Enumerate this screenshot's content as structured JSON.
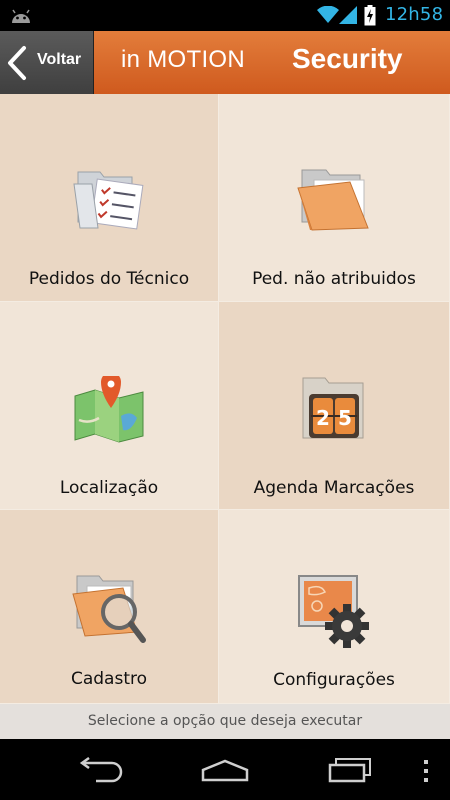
{
  "status_bar": {
    "time": "12h58"
  },
  "header": {
    "back_label": "Voltar",
    "brand": "in MOTION",
    "section": "Security"
  },
  "menu": {
    "items": [
      {
        "label": "Pedidos do Técnico",
        "icon": "checklist-folder-icon"
      },
      {
        "label": "Ped. não atribuidos",
        "icon": "open-folder-icon"
      },
      {
        "label": "Localização",
        "icon": "map-pin-icon"
      },
      {
        "label": "Agenda Marcações",
        "icon": "calendar-folder-icon"
      },
      {
        "label": "Cadastro",
        "icon": "folder-search-icon"
      },
      {
        "label": "Configurações",
        "icon": "settings-gear-icon"
      }
    ]
  },
  "footer": {
    "hint": "Selecione a opção que deseja executar"
  },
  "navigation": {
    "back_icon": "back-icon",
    "home_icon": "home-icon",
    "recents_icon": "recent-apps-icon",
    "menu_icon": "overflow-menu-icon"
  }
}
